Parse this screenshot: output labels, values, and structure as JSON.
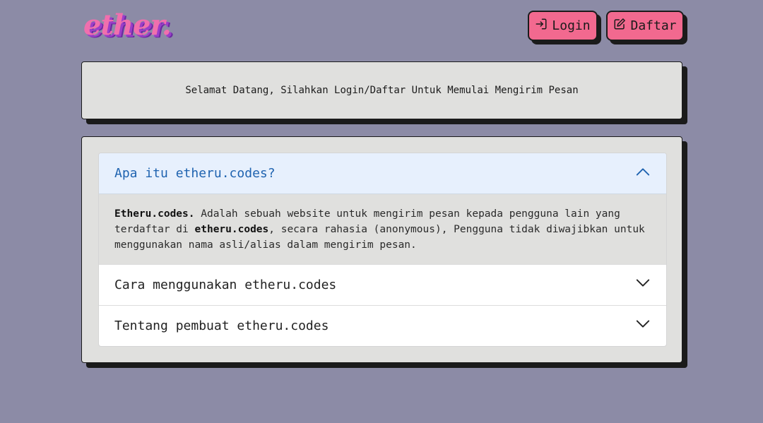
{
  "header": {
    "logo_text": "ether.",
    "login_label": "Login",
    "daftar_label": "Daftar",
    "login_icon": "login-icon",
    "daftar_icon": "edit-icon"
  },
  "welcome": {
    "text": "Selamat Datang, Silahkan Login/Daftar Untuk Memulai Mengirim Pesan"
  },
  "faq": {
    "items": [
      {
        "title": "Apa itu etheru.codes?",
        "expanded": true,
        "body": {
          "bold_1": "Etheru.codes.",
          "text_1": " Adalah sebuah website untuk mengirim pesan kepada pengguna lain yang terdaftar di ",
          "bold_2": "etheru.codes",
          "text_2": ", secara rahasia (anonymous), Pengguna tidak diwajibkan untuk menggunakan nama asli/alias dalam mengirim pesan."
        }
      },
      {
        "title": "Cara menggunakan etheru.codes",
        "expanded": false
      },
      {
        "title": "Tentang pembuat etheru.codes",
        "expanded": false
      }
    ]
  },
  "colors": {
    "background": "#8c8ba6",
    "button": "#f2698f",
    "card": "#e0e0de",
    "active_header": "#e7f0fd",
    "active_text": "#1f63b0"
  }
}
